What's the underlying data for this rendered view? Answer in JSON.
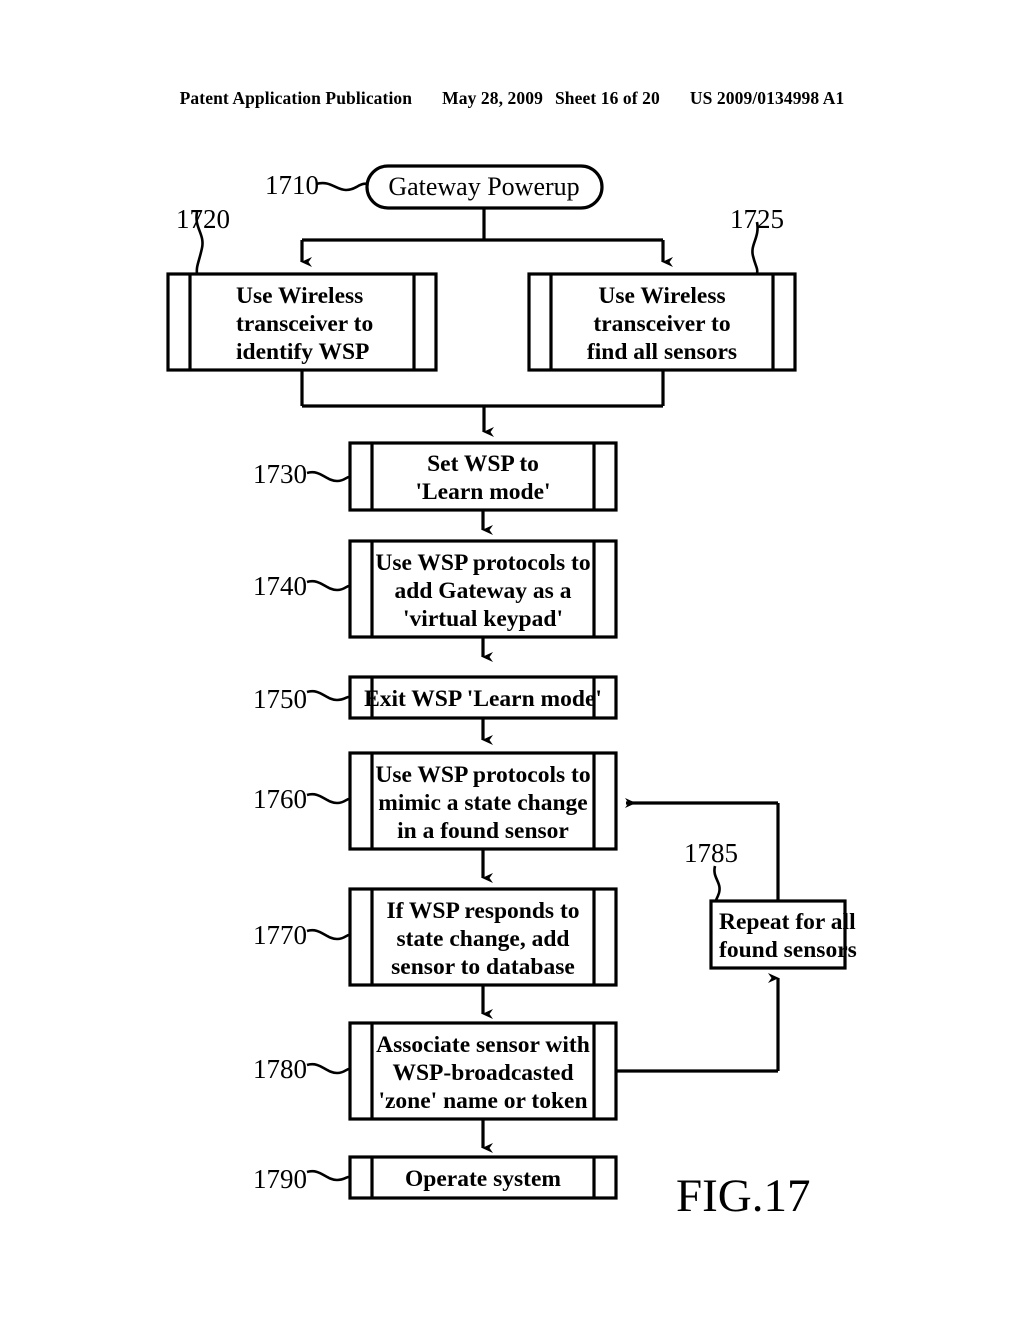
{
  "header": {
    "publication": "Patent Application Publication",
    "date": "May 28, 2009",
    "sheet": "Sheet 16 of 20",
    "patent_number": "US 2009/0134998 A1"
  },
  "figure": {
    "label": "FIG.17",
    "colors": {
      "ink": "#000000",
      "paper": "#ffffff"
    },
    "terminator": {
      "ref": "1710",
      "text": "Gateway Powerup"
    },
    "nodes": [
      {
        "ref": "1720",
        "shape": "predefined-process",
        "align": "left",
        "lines": [
          "Use Wireless",
          "transceiver to",
          "identify WSP"
        ]
      },
      {
        "ref": "1725",
        "shape": "predefined-process",
        "align": "center",
        "lines": [
          "Use Wireless",
          "transceiver to",
          "find all sensors"
        ]
      },
      {
        "ref": "1730",
        "shape": "predefined-process",
        "align": "center",
        "lines": [
          "Set WSP to",
          "'Learn mode'"
        ]
      },
      {
        "ref": "1740",
        "shape": "predefined-process",
        "align": "center",
        "lines": [
          "Use WSP protocols to",
          "add Gateway as a",
          "'virtual keypad'"
        ]
      },
      {
        "ref": "1750",
        "shape": "predefined-process",
        "align": "center",
        "lines": [
          "Exit WSP 'Learn mode'"
        ]
      },
      {
        "ref": "1760",
        "shape": "predefined-process",
        "align": "center",
        "lines": [
          "Use WSP protocols to",
          "mimic a state change",
          "in a found sensor"
        ]
      },
      {
        "ref": "1770",
        "shape": "predefined-process",
        "align": "center",
        "lines": [
          "If WSP responds to",
          "state change, add",
          "sensor to database"
        ]
      },
      {
        "ref": "1780",
        "shape": "predefined-process",
        "align": "center",
        "lines": [
          "Associate sensor with",
          "WSP-broadcasted",
          "'zone' name or token"
        ]
      },
      {
        "ref": "1790",
        "shape": "predefined-process",
        "align": "center",
        "lines": [
          "Operate system"
        ]
      },
      {
        "ref": "1785",
        "shape": "process",
        "align": "left",
        "lines": [
          "Repeat for all",
          "found sensors"
        ]
      }
    ],
    "node_text": {
      "n1720": {
        "l1": "Use Wireless",
        "l2": "transceiver to",
        "l3": "identify WSP"
      },
      "n1725": {
        "l1": "Use Wireless",
        "l2": "transceiver to",
        "l3": "find all sensors"
      },
      "n1730": {
        "l1": "Set WSP to",
        "l2": "'Learn mode'"
      },
      "n1740": {
        "l1": "Use WSP protocols to",
        "l2": "add Gateway as a",
        "l3": "'virtual keypad'"
      },
      "n1750": {
        "l1": "Exit WSP 'Learn mode'"
      },
      "n1760": {
        "l1": "Use WSP protocols to",
        "l2": "mimic a state change",
        "l3": "in a found sensor"
      },
      "n1770": {
        "l1": "If WSP responds to",
        "l2": "state change, add",
        "l3": "sensor to database"
      },
      "n1780": {
        "l1": "Associate sensor with",
        "l2": "WSP-broadcasted",
        "l3": "'zone' name or token"
      },
      "n1790": {
        "l1": "Operate system"
      },
      "n1785": {
        "l1": "Repeat for all",
        "l2": "found sensors"
      }
    },
    "refs": {
      "r1710": "1710",
      "r1720": "1720",
      "r1725": "1725",
      "r1730": "1730",
      "r1740": "1740",
      "r1750": "1750",
      "r1760": "1760",
      "r1770": "1770",
      "r1780": "1780",
      "r1785": "1785",
      "r1790": "1790"
    }
  }
}
